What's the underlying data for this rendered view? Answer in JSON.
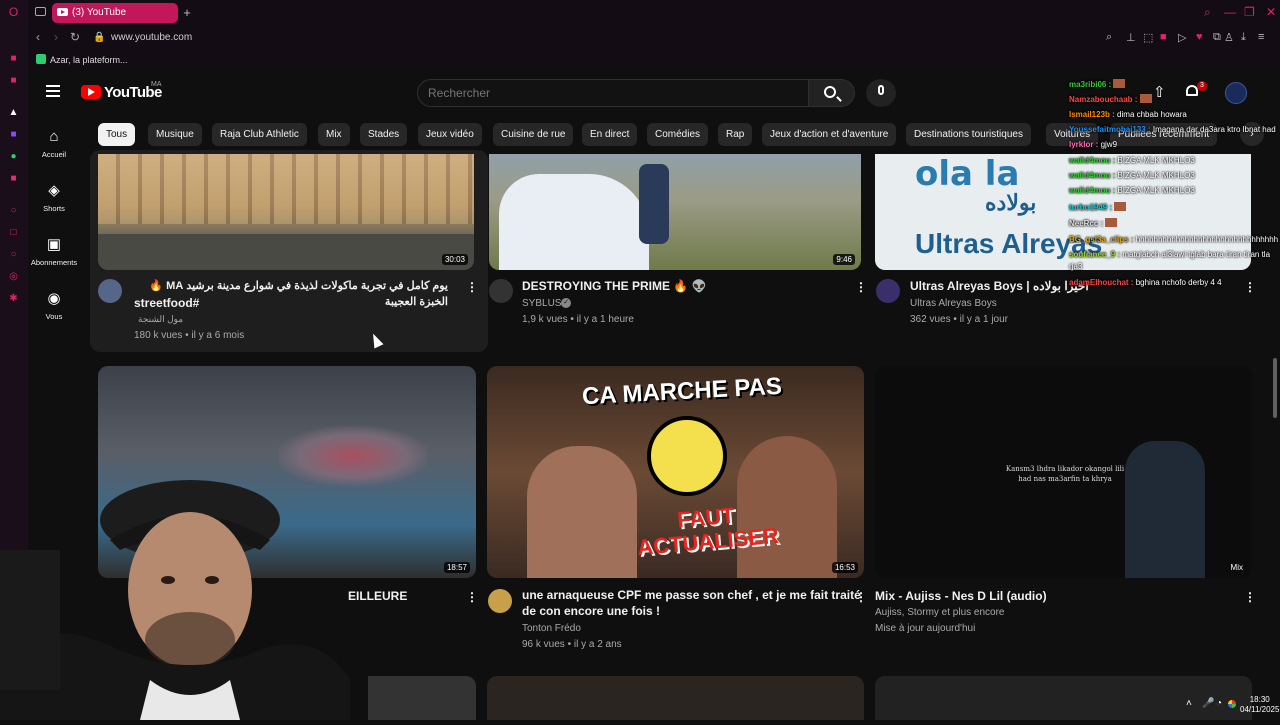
{
  "browser": {
    "tab_title": "(3) YouTube",
    "url": "www.youtube.com",
    "bookmark": "Azar, la plateform..."
  },
  "youtube": {
    "logo_text": "YouTube",
    "country_code": "MA",
    "search_placeholder": "Rechercher",
    "notification_count": "3",
    "chips": [
      "Tous",
      "Musique",
      "Raja Club Athletic",
      "Mix",
      "Stades",
      "Jeux vidéo",
      "Cuisine de rue",
      "En direct",
      "Comédies",
      "Rap",
      "Jeux d'action et d'aventure",
      "Destinations touristiques",
      "Voitures",
      "Publiées récemment"
    ],
    "nav": [
      {
        "label": "Accueil",
        "icon": "home-icon"
      },
      {
        "label": "Shorts",
        "icon": "shorts-icon"
      },
      {
        "label": "Abonnements",
        "icon": "subscriptions-icon"
      },
      {
        "label": "Vous",
        "icon": "you-icon"
      }
    ],
    "videos": [
      {
        "title": "يوم كامل في تجربة ماكولات لذيذة في شوارع مدينة برشيد MA 🔥 الخبزة العجيبة",
        "title2": "streetfood#",
        "channel": "مول الشنجة",
        "meta": "180 k vues  •  il y a 6 mois",
        "duration": "30:03"
      },
      {
        "title": "DESTROYING THE PRIME 🔥 👽",
        "channel": "SYBLUS",
        "meta": "1,9 k vues  •  il y a 1 heure",
        "duration": "9:46"
      },
      {
        "title": "Ultras Alreyas Boys | اخيرا بولاده",
        "channel": "Ultras Alreyas Boys",
        "meta": "362 vues  •  il y a 1 jour",
        "duration": ""
      },
      {
        "title": "EILLEURE",
        "channel": "",
        "meta": "",
        "duration": "18:57"
      },
      {
        "title": "une arnaqueuse CPF me passe son chef , et je me fait traité",
        "title2": "de con encore une fois !",
        "channel": "Tonton Frédo",
        "meta": "96 k vues  •  il y a 2 ans",
        "duration": "16:53",
        "thumb_text_top": "CA MARCHE PAS",
        "thumb_text_bottom": "FAUT ACTUALISER"
      },
      {
        "title": "Mix - Aujiss - Nes D Lil (audio)",
        "channel": "Aujiss, Stormy et plus encore",
        "meta": "Mise à jour aujourd'hui",
        "duration": "Mix",
        "thumb_lyrics": "Kansm3 lhdra likador okangol lili had nas ma3arfin ta khrya"
      }
    ],
    "thumb3_text_top": "ola la",
    "thumb3_text_mid": "بولاده",
    "thumb3_text_bottom": "Ultras Alreyas"
  },
  "chat": [
    {
      "user": "ma3ribi06 :",
      "msg": ""
    },
    {
      "user": "Namzabouchaab :",
      "msg": ""
    },
    {
      "user": "lsmail123b :",
      "msg": "dima chbab howara"
    },
    {
      "user": "Youssefaitmohai133 :",
      "msg": "Imagana dar da3ara ktro lbnat had"
    },
    {
      "user": "lyrklor :",
      "msg": "gjw9"
    },
    {
      "user": "walid4mou :",
      "msg": "BIZGA MLK MKHLO3"
    },
    {
      "user": "walid4mou :",
      "msg": "BIZGA MLK MKHLO3"
    },
    {
      "user": "walid4mou :",
      "msg": "BIZGA MLK MKHLO3"
    },
    {
      "user": "turbo1949 :",
      "msg": ""
    },
    {
      "user": "NeeRcc :",
      "msg": ""
    },
    {
      "user": "BG_gsl3a_clips :",
      "msg": "hhhhhhhhhhhhhhhhhhhhhhhhhhhhhhhh"
    },
    {
      "user": "soufianee_9 :",
      "msg": "matglabch al3lawi tglab bara tiran tiran tla"
    },
    {
      "user": "",
      "msg": "rja3"
    },
    {
      "user": "adamEIhouchat :",
      "msg": "bghina nchofo derby 4 4"
    }
  ],
  "tray": {
    "time": "18:30",
    "date": "04/11/2025"
  },
  "colors": {
    "bg": "#0f0f0f",
    "accent_red": "#ff0000",
    "opera_red": "#c2185b",
    "chip_bg": "#272727",
    "chat_user": "#32cd32"
  }
}
